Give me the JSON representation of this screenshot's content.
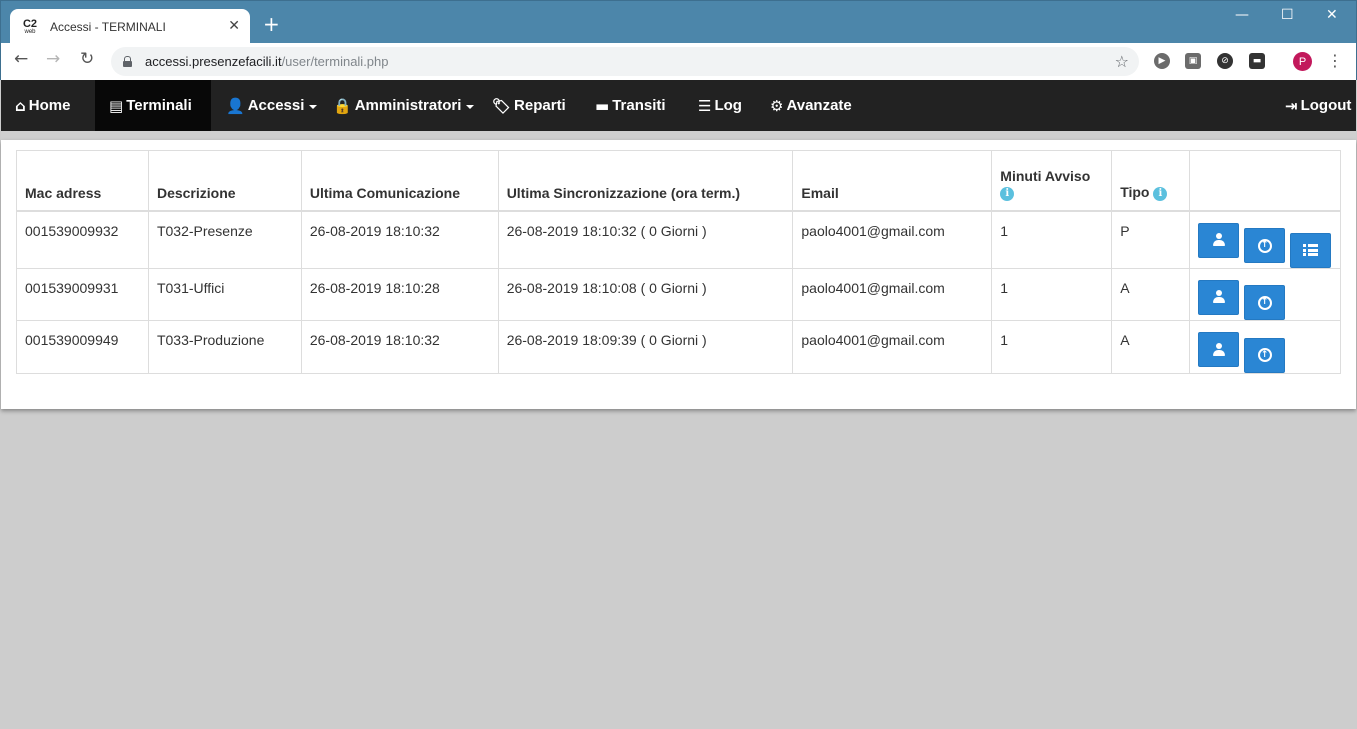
{
  "browser": {
    "tab_title": "Accessi - TERMINALI",
    "favicon_text": "C2",
    "favicon_sub": "web",
    "new_tab": "+",
    "url_host": "accessi.presenzefacili.it",
    "url_path": "/user/terminali.php",
    "profile_initial": "P",
    "window_controls": {
      "minimize": "—",
      "maximize": "☐",
      "close": "✕"
    }
  },
  "navbar": {
    "items": [
      {
        "label": "Home",
        "icon": "home-icon"
      },
      {
        "label": "Terminali",
        "icon": "terminal-icon",
        "active": true
      },
      {
        "label": "Accessi",
        "icon": "user-icon",
        "dropdown": true
      },
      {
        "label": "Amministratori",
        "icon": "lock-icon",
        "dropdown": true
      },
      {
        "label": "Reparti",
        "icon": "tags-icon"
      },
      {
        "label": "Transiti",
        "icon": "card-icon"
      },
      {
        "label": "Log",
        "icon": "server-icon"
      },
      {
        "label": "Avanzate",
        "icon": "gear-icon"
      }
    ],
    "logout": {
      "label": "Logout",
      "icon": "logout-icon"
    }
  },
  "table": {
    "headers": [
      "Mac adress",
      "Descrizione",
      "Ultima Comunicazione",
      "Ultima Sincronizzazione (ora term.)",
      "Email",
      "Minuti Avviso",
      "Tipo",
      ""
    ],
    "rows": [
      {
        "mac": "001539009932",
        "descrizione": "T032-Presenze",
        "comunicazione": "26-08-2019 18:10:32",
        "sincronizzazione": "26-08-2019 18:10:32 ( 0 Giorni )",
        "email": "paolo4001@gmail.com",
        "minuti": "1",
        "tipo": "P"
      },
      {
        "mac": "001539009931",
        "descrizione": "T031-Uffici",
        "comunicazione": "26-08-2019 18:10:28",
        "sincronizzazione": "26-08-2019 18:10:08 ( 0 Giorni )",
        "email": "paolo4001@gmail.com",
        "minuti": "1",
        "tipo": "A"
      },
      {
        "mac": "001539009949",
        "descrizione": "T033-Produzione",
        "comunicazione": "26-08-2019 18:10:32",
        "sincronizzazione": "26-08-2019 18:09:39 ( 0 Giorni )",
        "email": "paolo4001@gmail.com",
        "minuti": "1",
        "tipo": "A"
      }
    ]
  },
  "colors": {
    "titlebar": "#4c86aa",
    "navbar": "#222222",
    "navbar_active": "#080808",
    "button": "#2a86d4",
    "info_icon": "#5bc0de",
    "background": "#cdcdcd"
  }
}
